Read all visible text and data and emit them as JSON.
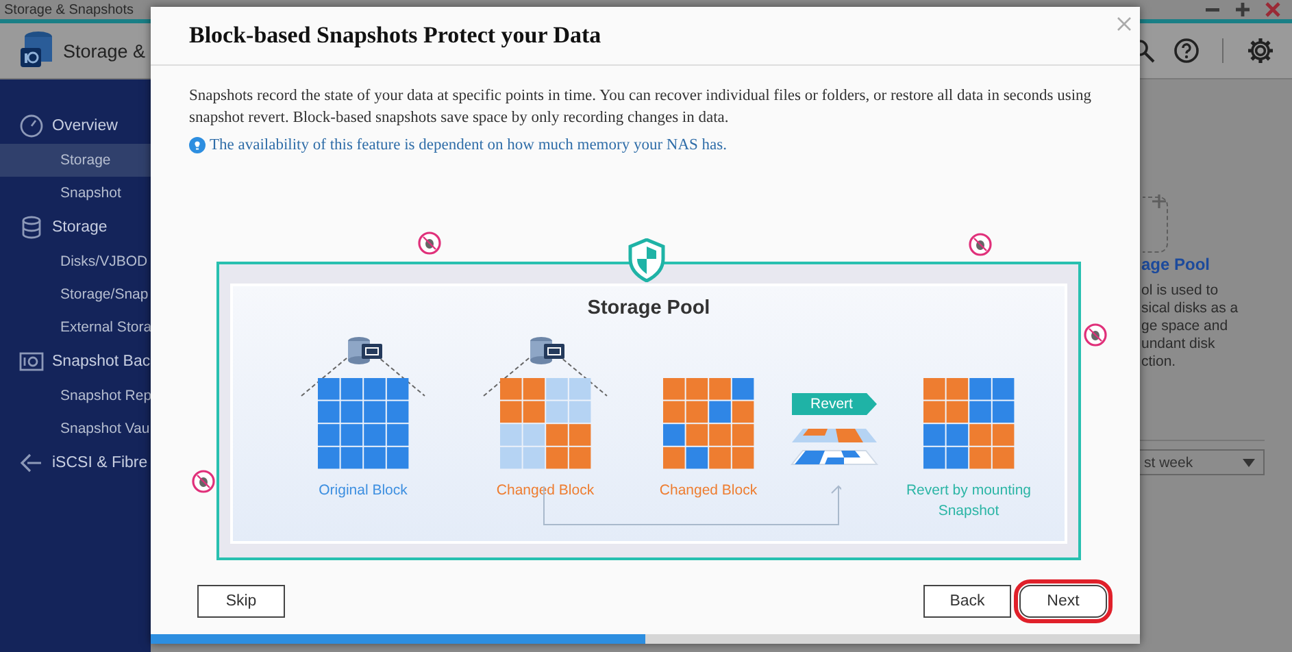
{
  "app": {
    "title": "Storage & Snapshots",
    "header_title": "Storage &"
  },
  "sidebar": [
    {
      "label": "Overview",
      "children": [
        {
          "label": "Storage",
          "selected": true
        },
        {
          "label": "Snapshot",
          "selected": false
        }
      ]
    },
    {
      "label": "Storage",
      "children": [
        {
          "label": "Disks/VJBOD",
          "selected": false
        },
        {
          "label": "Storage/Snap",
          "selected": false
        },
        {
          "label": "External Stora",
          "selected": false
        }
      ]
    },
    {
      "label": "Snapshot Bac",
      "children": [
        {
          "label": "Snapshot Rep",
          "selected": false
        },
        {
          "label": "Snapshot Vau",
          "selected": false
        }
      ]
    },
    {
      "label": "iSCSI & Fibre"
    }
  ],
  "background_panel": {
    "title": "age Pool",
    "lines": [
      "ol is used to",
      "sical disks as a",
      "ge space and",
      "undant disk",
      "ction."
    ],
    "range_select": "st week"
  },
  "dialog": {
    "title": "Block-based Snapshots Protect your Data",
    "paragraph": "Snapshots record the state of your data at specific points in time. You can recover individual files or folders, or restore all data in seconds using snapshot revert. Block-based snapshots save space by only recording changes in data.",
    "note": "The availability of this feature is dependent on how much memory your NAS has.",
    "diagram": {
      "title": "Storage Pool",
      "stages": [
        {
          "kind": "original",
          "label": "Original Block"
        },
        {
          "kind": "changed_live",
          "label": "Changed Block"
        },
        {
          "kind": "changed",
          "label": "Changed Block"
        },
        {
          "kind": "revert",
          "label": "Revert"
        },
        {
          "kind": "result",
          "label": "Revert by mounting Snapshot"
        }
      ]
    },
    "buttons": [
      {
        "kind": "skip",
        "label": "Skip",
        "highlighted": false
      },
      {
        "kind": "back",
        "label": "Back",
        "highlighted": false
      },
      {
        "kind": "next",
        "label": "Next",
        "highlighted": true
      }
    ],
    "progress": {
      "level": 0.5
    }
  }
}
